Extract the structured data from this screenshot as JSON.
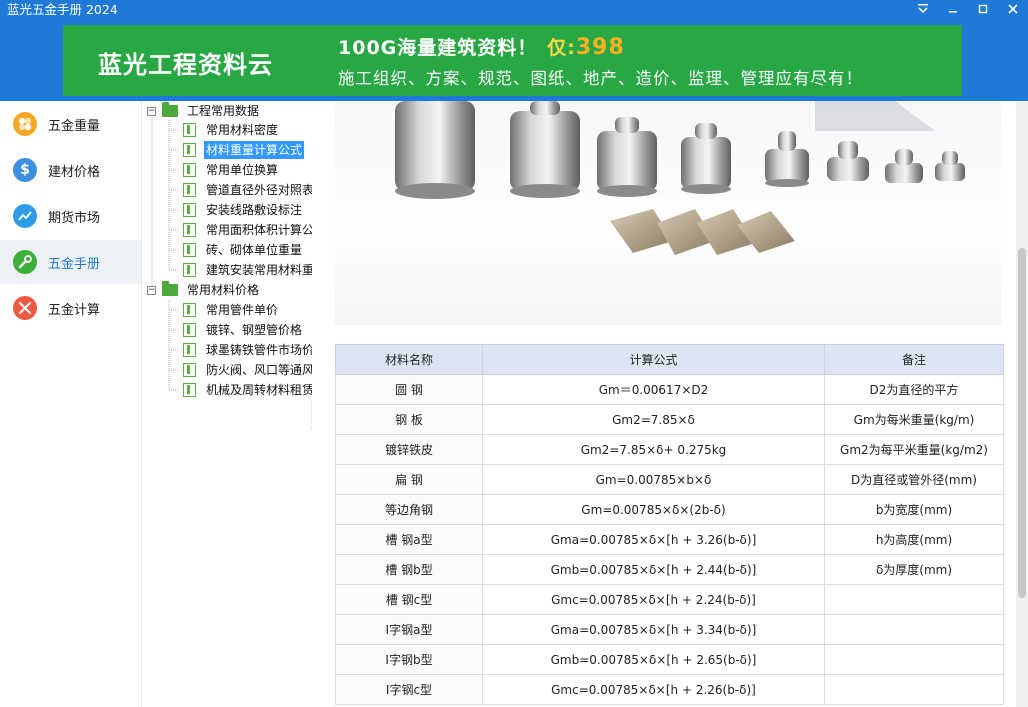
{
  "app": {
    "title": "蓝光五金手册 2024"
  },
  "banner": {
    "brand": "蓝光工程资料云",
    "headline": "100G海量建筑资料！",
    "price_label": "仅:",
    "price": "398",
    "subline": "施工组织、方案、规范、图纸、地产、造价、监理、管理应有尽有！"
  },
  "leftnav": {
    "items": [
      {
        "label": "五金重量",
        "icon": "puzzle-icon",
        "color": "#f5a623"
      },
      {
        "label": "建材价格",
        "icon": "dollar-icon",
        "color": "#3d8fe0"
      },
      {
        "label": "期货市场",
        "icon": "chart-line-icon",
        "color": "#2e9be6"
      },
      {
        "label": "五金手册",
        "icon": "wrench-icon",
        "color": "#3fae3a"
      },
      {
        "label": "五金计算",
        "icon": "tools-icon",
        "color": "#ec5a3f"
      }
    ],
    "active_index": 3
  },
  "tree": {
    "groups": [
      {
        "label": "工程常用数据",
        "children": [
          "常用材料密度",
          "材料重量计算公式",
          "常用单位换算",
          "管道直径外径对照表",
          "安装线路敷设标注",
          "常用面积体积计算公",
          "砖、砌体单位重量",
          "建筑安装常用材料重"
        ]
      },
      {
        "label": "常用材料价格",
        "children": [
          "常用管件单价",
          "镀锌、钢塑管价格",
          "球墨铸铁管件市场价",
          "防火阀、风口等通风",
          "机械及周转材料租赁"
        ]
      }
    ],
    "selected": "材料重量计算公式"
  },
  "table": {
    "headers": [
      "材料名称",
      "计算公式",
      "备注"
    ],
    "rows": [
      [
        "圆 钢",
        "Gm＝0.00617×D2",
        "D2为直径的平方"
      ],
      [
        "钢 板",
        "Gm2=7.85×δ",
        "Gm为每米重量(kg/m)"
      ],
      [
        "镀锌铁皮",
        "Gm2=7.85×δ+ 0.275kg",
        "Gm2为每平米重量(kg/m2)"
      ],
      [
        "扁 钢",
        "Gm=0.00785×b×δ",
        "D为直径或管外径(mm)"
      ],
      [
        "等边角钢",
        "Gm=0.00785×δ×(2b-δ)",
        "b为宽度(mm)"
      ],
      [
        "槽 钢a型",
        "Gma=0.00785×δ×[h + 3.26(b-δ)]",
        "h为高度(mm)"
      ],
      [
        "槽 钢b型",
        "Gmb=0.00785×δ×[h + 2.44(b-δ)]",
        "δ为厚度(mm)"
      ],
      [
        "槽 钢c型",
        "Gmc=0.00785×δ×[h + 2.24(b-δ)]",
        ""
      ],
      [
        "I字钢a型",
        "Gma=0.00785×δ×[h + 3.34(b-δ)]",
        ""
      ],
      [
        "I字钢b型",
        "Gmb=0.00785×δ×[h + 2.65(b-δ)]",
        ""
      ],
      [
        "I字钢c型",
        "Gmc=0.00785×δ×[h + 2.26(b-δ)]",
        ""
      ]
    ]
  }
}
